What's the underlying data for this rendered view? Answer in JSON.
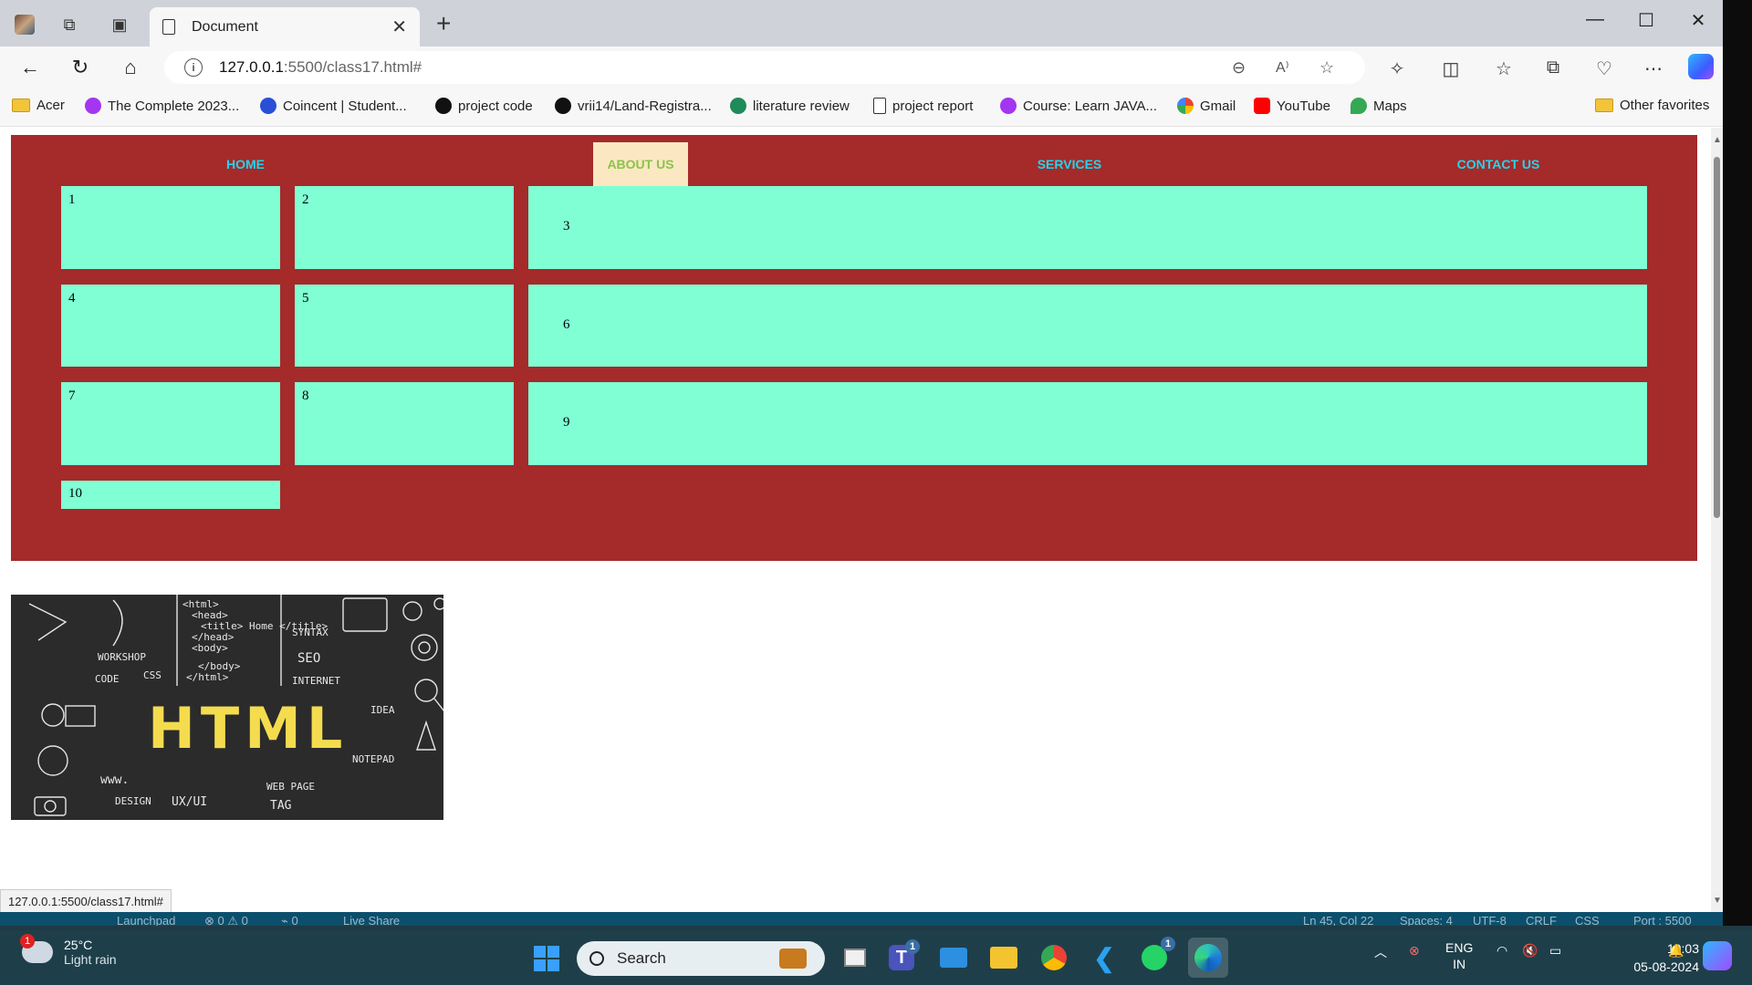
{
  "browser": {
    "tab_title": "Document",
    "url_host": "127.0.0.1",
    "url_path": ":5500/class17.html#",
    "zoom_icon": "zoom-out-icon",
    "read_aloud_label": "A⁾"
  },
  "favorites": [
    {
      "label": "Acer",
      "icon": "folder-icon",
      "color": "#f1c43a"
    },
    {
      "label": "The Complete 2023...",
      "icon": "udemy-icon",
      "color": "#a435f0"
    },
    {
      "label": "Coincent | Student...",
      "icon": "coincent-icon",
      "color": "#2a4fd6"
    },
    {
      "label": "project code",
      "icon": "github-icon",
      "color": "#111111"
    },
    {
      "label": "vrii14/Land-Registra...",
      "icon": "github-icon",
      "color": "#111111"
    },
    {
      "label": "literature review",
      "icon": "link-icon",
      "color": "#1f8a5a"
    },
    {
      "label": "project report",
      "icon": "page-icon",
      "color": "#ffffff"
    },
    {
      "label": "Course: Learn JAVA...",
      "icon": "udemy-icon",
      "color": "#a435f0"
    },
    {
      "label": "Gmail",
      "icon": "google-icon",
      "color": "#ea4335"
    },
    {
      "label": "YouTube",
      "icon": "youtube-icon",
      "color": "#ff0000"
    },
    {
      "label": "Maps",
      "icon": "maps-icon",
      "color": "#34a853"
    }
  ],
  "other_favorites": "Other favorites",
  "page": {
    "nav": [
      {
        "label": "HOME"
      },
      {
        "label": "ABOUT US"
      },
      {
        "label": "SERVICES"
      },
      {
        "label": "CONTACT US"
      }
    ],
    "cells": [
      "1",
      "2",
      "3",
      "4",
      "5",
      "6",
      "7",
      "8",
      "9",
      "10"
    ],
    "hero": {
      "big_text": "HTML",
      "snippets": [
        "<html>",
        "<head>",
        "<title> Home </title>",
        "</head>",
        "<body>",
        "</body>",
        "</html>",
        "SYNTAX",
        "SEO",
        "INTERNET",
        "WORKSHOP",
        "CODE",
        "CSS",
        "IDEA",
        "NOTEPAD",
        "www.",
        "DESIGN",
        "UX/UI",
        "WEB PAGE",
        "TAG"
      ]
    },
    "colors": {
      "container": "#a52a2a",
      "cell": "#80ffd5",
      "nav_text": "#20d6ec",
      "active_bg": "#fbe8c3",
      "active_text": "#8bc34a"
    }
  },
  "status_url": "127.0.0.1:5500/class17.html#",
  "vscode_status": {
    "launchpad": "Launchpad",
    "problems": "⊗ 0 ⚠ 0",
    "ports": "⌁ 0",
    "live_share": "Live Share",
    "cursor": "Ln 45, Col 22",
    "spaces": "Spaces: 4",
    "encoding": "UTF-8",
    "eol": "CRLF",
    "language": "CSS",
    "port": "Port : 5500"
  },
  "taskbar": {
    "weather_temp": "25°C",
    "weather_desc": "Light rain",
    "weather_badge": "1",
    "search_placeholder": "Search",
    "teams_badge": "1",
    "whatsapp_badge": "1",
    "lang_top": "ENG",
    "lang_bottom": "IN",
    "time": "19:03",
    "date": "05-08-2024"
  }
}
